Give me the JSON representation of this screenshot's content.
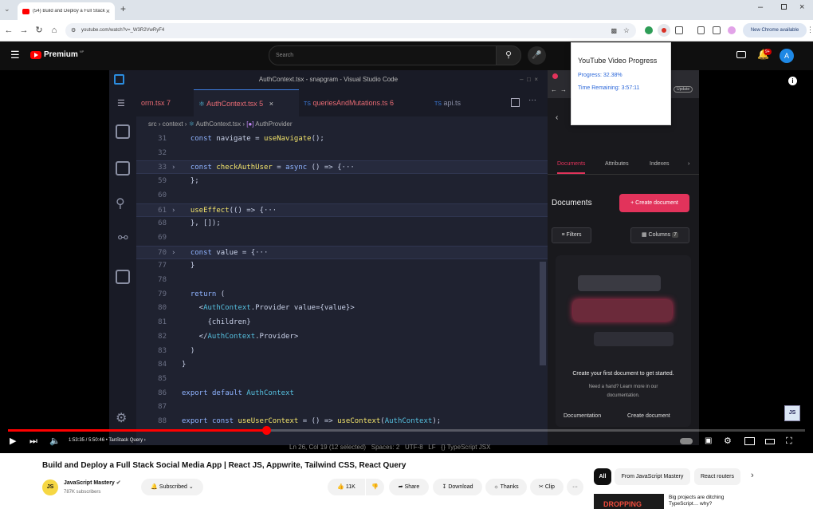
{
  "browser": {
    "tab_title": "(54) Build and Deploy a Full Stack",
    "url": "youtube.com/watch?v=_W3R2VwRyF4",
    "new_chrome_label": "New Chrome available"
  },
  "youtube": {
    "logo_text": "Premium",
    "logo_region": "NP",
    "search_placeholder": "Search",
    "notif_count": "9+",
    "account_initial": "A"
  },
  "vscode": {
    "window_title": "AuthContext.tsx - snapgram - Visual Studio Code",
    "tabs": [
      {
        "label": "orm.tsx",
        "badge": "7"
      },
      {
        "label": "AuthContext.tsx",
        "badge": "5"
      },
      {
        "label": "queriesAndMutations.ts",
        "badge": "6"
      },
      {
        "label": "api.ts",
        "badge": ""
      }
    ],
    "breadcrumb": [
      "src",
      "context",
      "AuthContext.tsx",
      "AuthProvider"
    ],
    "lines": [
      {
        "n": "31",
        "text": "  const navigate = useNavigate();"
      },
      {
        "n": "32",
        "text": ""
      },
      {
        "n": "33",
        "text": "  const checkAuthUser = async () => {···"
      },
      {
        "n": "59",
        "text": "  };"
      },
      {
        "n": "60",
        "text": ""
      },
      {
        "n": "61",
        "text": "  useEffect(() => {···"
      },
      {
        "n": "68",
        "text": "  }, []);"
      },
      {
        "n": "69",
        "text": ""
      },
      {
        "n": "70",
        "text": "  const value = {···"
      },
      {
        "n": "77",
        "text": "  }"
      },
      {
        "n": "78",
        "text": ""
      },
      {
        "n": "79",
        "text": "  return ("
      },
      {
        "n": "80",
        "text": "    <AuthContext.Provider value={value}>"
      },
      {
        "n": "81",
        "text": "      {children}"
      },
      {
        "n": "82",
        "text": "    </AuthContext.Provider>"
      },
      {
        "n": "83",
        "text": "  )"
      },
      {
        "n": "84",
        "text": "}"
      },
      {
        "n": "85",
        "text": ""
      },
      {
        "n": "86",
        "text": "export default AuthContext"
      },
      {
        "n": "87",
        "text": ""
      },
      {
        "n": "88",
        "text": "export const useUserContext = () => useContext(AuthContext);"
      }
    ],
    "status": "Ln 26, Col 19 (12 selected)   Spaces: 2   UTF-8   LF   {} TypeScript JSX"
  },
  "appwrite": {
    "update_label": "Update",
    "tabs": [
      "Documents",
      "Attributes",
      "Indexes"
    ],
    "heading": "Documents",
    "create_button": "Create document",
    "filters_label": "Filters",
    "columns_label": "Columns",
    "columns_count": "7",
    "empty_title": "Create your first document to get started.",
    "empty_help": "Need a hand? Learn more in our documentation.",
    "doc_link": "Documentation",
    "create_link": "Create document"
  },
  "progress_popup": {
    "title": "YouTube Video Progress",
    "progress": "Progress: 32.38%",
    "remaining": "Time Remaining: 3:57:11"
  },
  "player": {
    "progress_fraction": 0.3238,
    "time": "1:53:35 / 5:50:46",
    "chapter": "• TanStack Query ›"
  },
  "video": {
    "title": "Build and Deploy a Full Stack Social Media App | React JS, Appwrite, Tailwind CSS, React Query",
    "channel_name": "JavaScript Mastery",
    "channel_avatar": "JS",
    "subscribers": "787K subscribers",
    "subscribed_label": "Subscribed",
    "likes": "11K",
    "share_label": "Share",
    "download_label": "Download",
    "thanks_label": "Thanks",
    "clip_label": "Clip"
  },
  "chips": [
    "All",
    "From JavaScript Mastery",
    "React routers"
  ],
  "recommended": {
    "thumb_text": "DROPPING",
    "title": "Big projects are ditching TypeScript… why?"
  },
  "colors": {
    "youtube_red": "#ff0000",
    "appwrite_pink": "#e2335b",
    "popup_blue": "#2b67d9"
  }
}
